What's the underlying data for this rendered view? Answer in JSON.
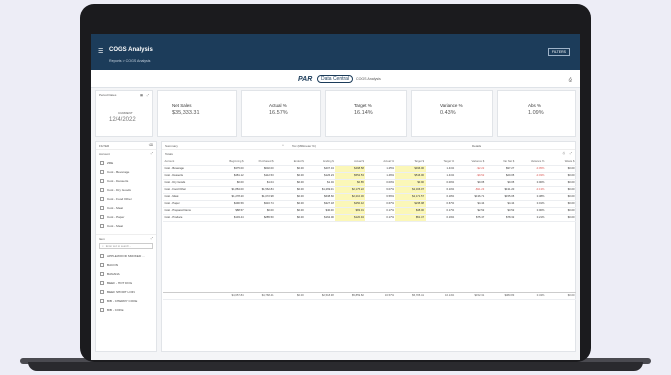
{
  "app": {
    "title": "COGS Analysis",
    "breadcrumb": "Reports > COGS Analysis",
    "filters_label": "FILTERS"
  },
  "brand": {
    "logo": "PAR",
    "pill": "Data Central",
    "subtitle": "COGS Analysis"
  },
  "period": {
    "label": "Period Dates",
    "current_label": "CURRENT",
    "date": "12/4/2022"
  },
  "kpis": [
    {
      "label": "Net Sales",
      "value": "$35,333.31"
    },
    {
      "label": "Actual %",
      "value": "16.57%"
    },
    {
      "label": "Target %",
      "value": "16.14%"
    },
    {
      "label": "Variance %",
      "value": "0.43%"
    },
    {
      "label": "Abs %",
      "value": "1.09%"
    }
  ],
  "filters": {
    "title": "FILTER",
    "account_label": "Account",
    "accounts": [
      "ZRE",
      "Cost - Beverage",
      "Cost - Desserts",
      "Cost - Dry Goods",
      "Cost - Food Other",
      "Cost - Meat",
      "Cost - Paper",
      "Cost - Meat"
    ],
    "item_label": "Item",
    "item_search_placeholder": "Enter text to search...",
    "items": [
      "APPLEWOOD SMOKED ...",
      "BACON",
      "BANANA",
      "BEEF - HOT DOG",
      "BEEF SHORT LOIN",
      "BIB - CHERRY COKE",
      "BIB - COKE"
    ]
  },
  "table_panel": {
    "summary_label": "Summary",
    "toc_label": "Toc (Millimeter %)",
    "details_label": "Details",
    "title": "Totals",
    "columns": [
      "Account",
      "Beginning $",
      "Purchased $",
      "Ended $",
      "Ending $",
      "Actual $",
      "Actual %",
      "Target $",
      "Target %",
      "Variance $",
      "Var Net $",
      "Variance %",
      "Waste $"
    ],
    "rows": [
      [
        "Cost - Beverage",
        "$375.00",
        "$602.00",
        "$0.00",
        "$407.34",
        "$498.58",
        "1.25%",
        "$496.00",
        "1.41%",
        "-$2.22",
        "$97.27",
        "-0.05%",
        "$0.00"
      ],
      [
        "Cost - Desserts",
        "$481.12",
        "$112.53",
        "$0.00",
        "$126.23",
        "$552.53",
        "1.46%",
        "$516.00",
        "1.41%",
        "-$9.52",
        "$20.05",
        "-0.03%",
        "$0.00"
      ],
      [
        "Cost - Dry Goods",
        "$0.00",
        "$1.04",
        "$0.00",
        "$1.04",
        "$0.85",
        "0.00%",
        "$0.90",
        "0.00%",
        "$0.05",
        "$0.05",
        "0.00%",
        "$0.00"
      ],
      [
        "Cost - Food Other",
        "$1,884.00",
        "$1,562.84",
        "$0.00",
        "$1,269.01",
        "$2,175.22",
        "6.07%",
        "$2,166.07",
        "6.10%",
        "-$91.23",
        "$131.20",
        "-0.13%",
        "$0.00"
      ],
      [
        "Cost - Meat",
        "$1,278.20",
        "$1,072.98",
        "$0.00",
        "$638.60",
        "$2,210.30",
        "6.56%",
        "$2,171.57",
        "6.18%",
        "$136.71",
        "$155.05",
        "0.38%",
        "$0.00"
      ],
      [
        "Cost - Paper",
        "$490.59",
        "$316.74",
        "$0.00",
        "$327.18",
        "$250.42",
        "0.67%",
        "$235.98",
        "0.67%",
        "$4.44",
        "$4.44",
        "0.01%",
        "$0.00"
      ],
      [
        "Cost - Prepared Items",
        "$88.57",
        "$0.00",
        "$0.00",
        "$40.00",
        "$83.01",
        "0.17%",
        "$48.00",
        "0.17%",
        "$2.52",
        "$3.52",
        "0.00%",
        "$0.00"
      ],
      [
        "Cost - Produce",
        "$103.44",
        "$285.50",
        "$0.00",
        "$162.00",
        "$120.94",
        "0.17%",
        "$51.47",
        "0.19%",
        "$75.47",
        "$78.32",
        "0.21%",
        "$0.00"
      ]
    ],
    "totals": [
      "",
      "$4,657.84",
      "$4,768.41",
      "$0.00",
      "$2,518.38",
      "$5,859.82",
      "16.57%",
      "$5,705.41",
      "16.14%",
      "$152.31",
      "$383.83",
      "0.43%",
      "$0.00"
    ]
  }
}
